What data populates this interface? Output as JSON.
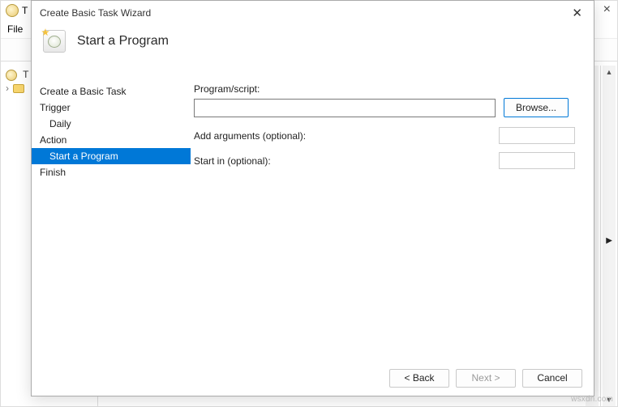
{
  "bg": {
    "title_prefix": "T",
    "menu_file": "File",
    "tree_prefix": "T"
  },
  "dialog": {
    "title": "Create Basic Task Wizard",
    "heading": "Start a Program",
    "steps": {
      "create": "Create a Basic Task",
      "trigger": "Trigger",
      "daily": "Daily",
      "action": "Action",
      "start_program": "Start a Program",
      "finish": "Finish"
    },
    "form": {
      "program_label": "Program/script:",
      "program_value": "",
      "browse": "Browse...",
      "args_label": "Add arguments (optional):",
      "args_value": "",
      "startin_label": "Start in (optional):",
      "startin_value": ""
    },
    "buttons": {
      "back": "< Back",
      "next": "Next >",
      "cancel": "Cancel"
    }
  },
  "watermark": "wsxdn.com"
}
